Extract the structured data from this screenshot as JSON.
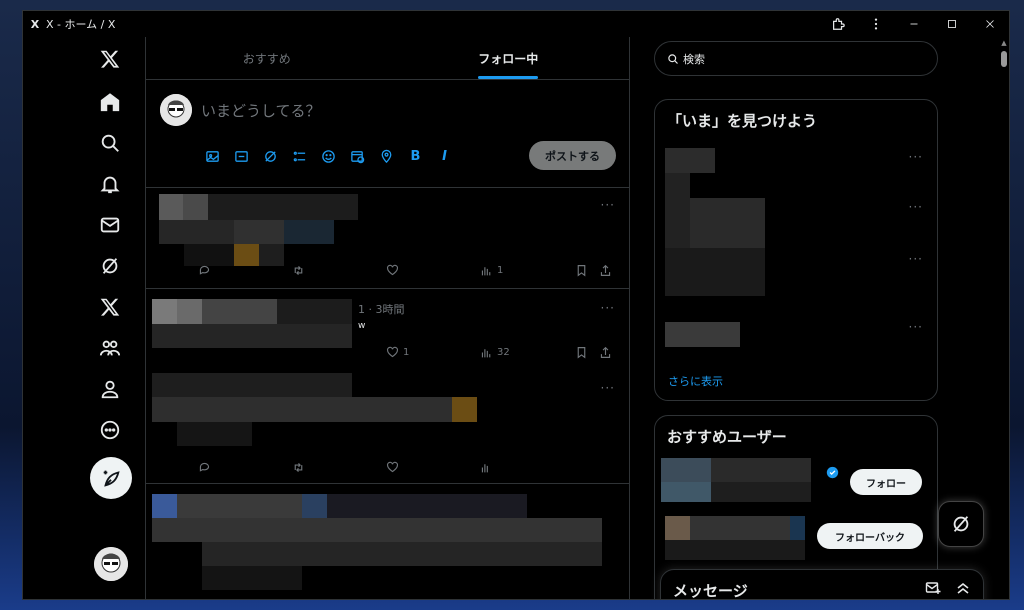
{
  "window": {
    "title": "X - ホーム / X",
    "logo": "X"
  },
  "titlebar": {
    "icons": [
      "extension-icon",
      "kebab-menu-icon"
    ],
    "controls": [
      "minimize",
      "maximize",
      "close"
    ]
  },
  "nav": {
    "items": [
      "home",
      "explore",
      "notifications",
      "messages",
      "grok",
      "premium",
      "communities",
      "profile",
      "more"
    ],
    "compose": "compose-post"
  },
  "tabs": [
    {
      "label": "おすすめ",
      "active": false
    },
    {
      "label": "フォロー中",
      "active": true
    }
  ],
  "composer": {
    "placeholder": "いまどうしてる？",
    "bold_tool": "B",
    "italic_tool": "I",
    "post_button": "ポストする"
  },
  "posts": [
    {
      "views": "1"
    },
    {
      "meta": "1 · 3時間",
      "likes": "1",
      "views": "32",
      "fragment": "w"
    }
  ],
  "search": {
    "placeholder": "検索"
  },
  "trends": {
    "title": "「いま」を見つけよう",
    "show_more": "さらに表示"
  },
  "who_to_follow": {
    "title": "おすすめユーザー",
    "follow_label": "フォロー",
    "follow_back_label": "フォローバック"
  },
  "messages_drawer": {
    "title": "メッセージ"
  },
  "colors": {
    "accent": "#1d9bf0",
    "background": "#000000",
    "border": "#2f3336",
    "muted": "#71767b"
  }
}
